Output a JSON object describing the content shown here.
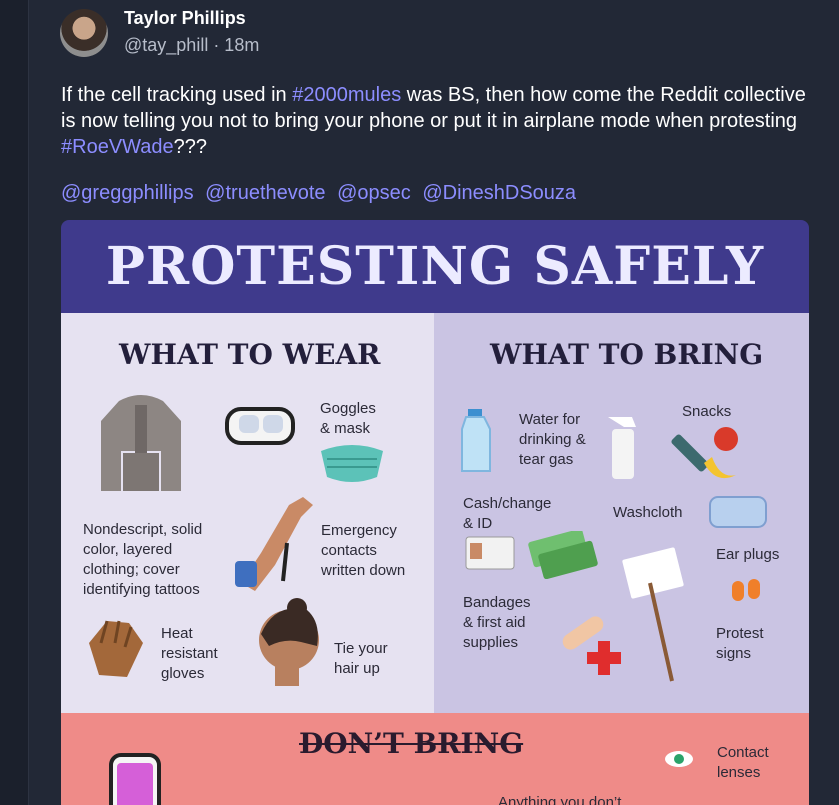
{
  "post": {
    "author_name": "Taylor Phillips",
    "handle_time": "@tay_phill · 18m",
    "text_part1": "If the cell tracking used in ",
    "hashtag1": "#2000mules",
    "text_part2": " was BS, then how come the Reddit collective is now telling you not to bring your phone or put it in airplane mode when protesting ",
    "hashtag2": "#RoeVWade",
    "text_part3": "???",
    "mentions": [
      "@greggphillips",
      "@truethevote",
      "@opsec",
      "@DineshDSouza"
    ]
  },
  "infographic": {
    "title": "PROTESTING SAFELY",
    "wear": {
      "heading": "WHAT TO WEAR",
      "goggles": "Goggles\n& mask",
      "clothing": "Nondescript, solid\ncolor, layered\nclothing; cover\nidentifying tattoos",
      "emergency": "Emergency\ncontacts\nwritten down",
      "gloves": "Heat\nresistant\ngloves",
      "hair": "Tie your\nhair up"
    },
    "bring": {
      "heading": "WHAT TO BRING",
      "water": "Water for\ndrinking &\ntear gas",
      "snacks": "Snacks",
      "cash": "Cash/change\n& ID",
      "washcloth": "Washcloth",
      "earplugs": "Ear plugs",
      "bandages": "Bandages\n& first aid\nsupplies",
      "signs": "Protest\nsigns"
    },
    "dont": {
      "heading": "DON’T BRING",
      "contacts": "Contact\nlenses",
      "anything": "Anything you don’t"
    }
  },
  "colors": {
    "background": "#1e2330",
    "link": "#8c8dff",
    "banner": "#3f3a8c",
    "wear_bg": "#e6e2f1",
    "bring_bg": "#cac4e3",
    "dont_bg": "#ef8b88"
  }
}
